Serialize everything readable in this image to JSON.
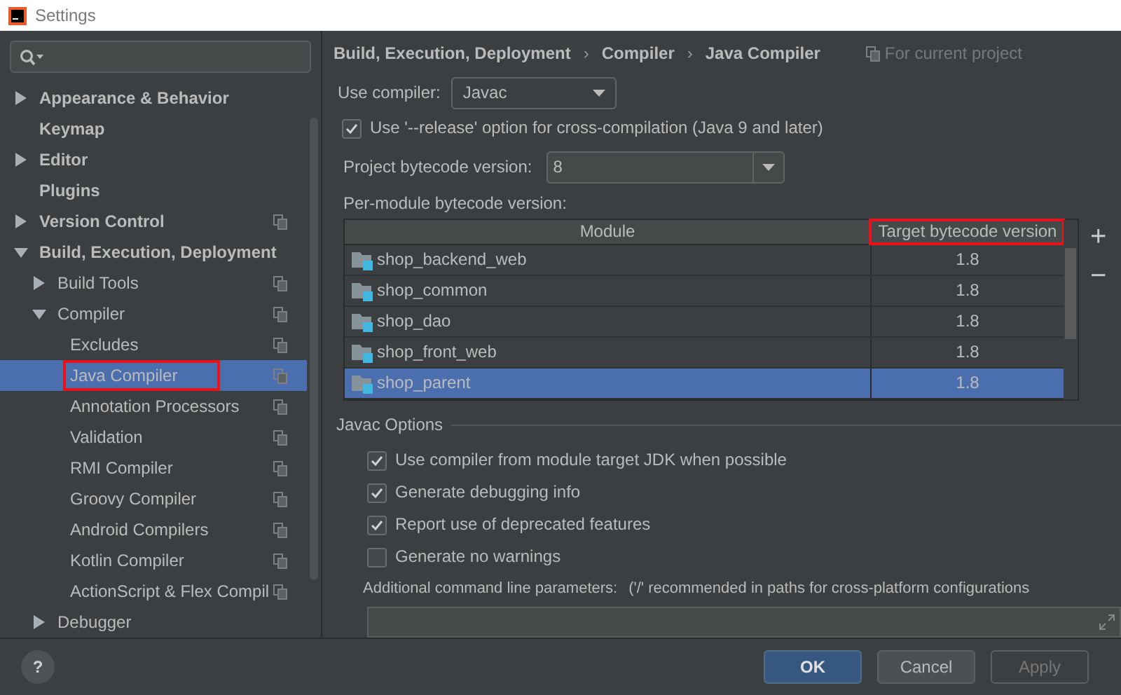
{
  "window": {
    "title": "Settings"
  },
  "sidebar": {
    "items": [
      {
        "label": "Appearance & Behavior",
        "expanded": false,
        "selected": false
      },
      {
        "label": "Keymap",
        "selected": false
      },
      {
        "label": "Editor",
        "expanded": false,
        "selected": false
      },
      {
        "label": "Plugins",
        "selected": false
      },
      {
        "label": "Version Control",
        "expanded": false,
        "selected": false,
        "project_scoped": true
      },
      {
        "label": "Build, Execution, Deployment",
        "expanded": true,
        "selected": false,
        "children": [
          {
            "label": "Build Tools",
            "expanded": false,
            "selected": false,
            "project_scoped": true
          },
          {
            "label": "Compiler",
            "expanded": true,
            "selected": false,
            "project_scoped": true,
            "children": [
              {
                "label": "Excludes",
                "selected": false,
                "project_scoped": true
              },
              {
                "label": "Java Compiler",
                "selected": true,
                "highlighted": true,
                "project_scoped": true
              },
              {
                "label": "Annotation Processors",
                "selected": false,
                "project_scoped": true
              },
              {
                "label": "Validation",
                "selected": false,
                "project_scoped": true
              },
              {
                "label": "RMI Compiler",
                "selected": false,
                "project_scoped": true
              },
              {
                "label": "Groovy Compiler",
                "selected": false,
                "project_scoped": true
              },
              {
                "label": "Android Compilers",
                "selected": false,
                "project_scoped": true
              },
              {
                "label": "Kotlin Compiler",
                "selected": false,
                "project_scoped": true
              },
              {
                "label": "ActionScript & Flex Compil",
                "selected": false,
                "project_scoped": true
              }
            ]
          },
          {
            "label": "Debugger",
            "expanded": false,
            "selected": false
          }
        ]
      }
    ]
  },
  "breadcrumb": {
    "items": [
      "Build, Execution, Deployment",
      "Compiler",
      "Java Compiler"
    ],
    "separator": "›",
    "scope": "For current project"
  },
  "use_compiler": {
    "label": "Use compiler:",
    "value": "Javac"
  },
  "release_option": {
    "label": "Use '--release' option for cross-compilation (Java 9 and later)",
    "checked": true
  },
  "project_bytecode": {
    "label": "Project bytecode version:",
    "value": "8"
  },
  "per_module": {
    "label": "Per-module bytecode version:",
    "columns": [
      {
        "label": "Module",
        "highlighted": false
      },
      {
        "label": "Target bytecode version",
        "highlighted": true
      }
    ],
    "rows": [
      {
        "module": "shop_backend_web",
        "version": "1.8",
        "selected": false
      },
      {
        "module": "shop_common",
        "version": "1.8",
        "selected": false
      },
      {
        "module": "shop_dao",
        "version": "1.8",
        "selected": false
      },
      {
        "module": "shop_front_web",
        "version": "1.8",
        "selected": false
      },
      {
        "module": "shop_parent",
        "version": "1.8",
        "selected": true
      }
    ],
    "add": "+",
    "remove": "−"
  },
  "javac_options": {
    "title": "Javac Options",
    "options": [
      {
        "label": "Use compiler from module target JDK when possible",
        "checked": true
      },
      {
        "label": "Generate debugging info",
        "checked": true
      },
      {
        "label": "Report use of deprecated features",
        "checked": true
      },
      {
        "label": "Generate no warnings",
        "checked": false
      }
    ],
    "params_label": "Additional command line parameters:",
    "params_hint": "('/' recommended in paths for cross-platform configurations"
  },
  "buttons": [
    {
      "label": "OK",
      "kind": "primary",
      "disabled": false
    },
    {
      "label": "Cancel",
      "kind": "normal",
      "disabled": false
    },
    {
      "label": "Apply",
      "kind": "normal",
      "disabled": true
    }
  ],
  "help": "?"
}
